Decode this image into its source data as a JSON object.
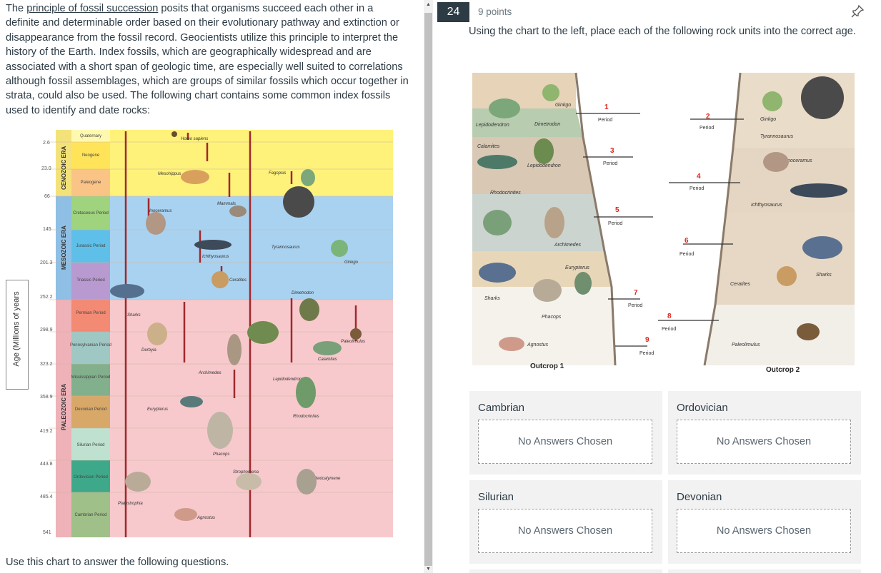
{
  "intro": {
    "link_text": "principle of fossil succession",
    "prefix": "The",
    "body": "posits that organisms succeed each other in a definite and determinable order based on their evolutionary pathway and extinction or disappearance from the fossil record. Geocientists utilize this principle to interpret the history of the Earth. Index fossils, which are geographically widespread and are associated with a short span of geologic time, are especially well suited to correlations although fossil assemblages, which are groups of similar fossils which occur together in strata, could also be used. The following chart contains some common index fossils used to identify and date rocks:"
  },
  "footer_text": "Use this chart to answer the following questions.",
  "chart": {
    "ylabel": "Age (Millions of years",
    "ages": [
      "2.6",
      "23.0",
      "66",
      "145",
      "201.3",
      "252.2",
      "298.9",
      "323.2",
      "358.9",
      "419.2",
      "443.8",
      "485.4",
      "541"
    ],
    "eras": [
      "CENOZOIC ERA",
      "MESOZOIC ERA",
      "PALEOZOIC ERA"
    ],
    "periods": [
      "Quaternary",
      "Neogene",
      "Paleogene",
      "Cretaceous Period",
      "Jurassic Period",
      "Triassic Period",
      "Permian Period",
      "Pennsylvanian Period",
      "Mississippian Period",
      "Devonian Period",
      "Silurian Period",
      "Ordovician Period",
      "Cambrian Period"
    ],
    "fossils": [
      "Homo sapiens",
      "Mesohippus",
      "Fagopsis",
      "Mammals",
      "Inoceramus",
      "Ichthyosaurus",
      "Tyrannosaurus",
      "Ginkgo",
      "Ceratites",
      "Sharks",
      "Dimetrodon",
      "Paleolimulus",
      "Derbyia",
      "Archimedes",
      "Calamites",
      "Lepidodendron",
      "Eurypterus",
      "Rhodocrinites",
      "Phacops",
      "Strophomena",
      "Flexicalymene",
      "Platystrophia",
      "Agnostus"
    ],
    "colors": {
      "cenozoic": "#fff27a",
      "mesozoic": "#a9d2f0",
      "paleozoic": "#f7c9cc",
      "arrow": "#a0282d"
    }
  },
  "question": {
    "number": "24",
    "points": "9 points",
    "text": "Using the chart to the left, place each of the following rock units into the correct age."
  },
  "outcrop": {
    "outcrop1": "Outcrop 1",
    "outcrop2": "Outcrop 2",
    "period_word": "Period",
    "numbers": [
      "1",
      "2",
      "3",
      "4",
      "5",
      "6",
      "7",
      "8",
      "9"
    ],
    "fossils1": [
      "Ginkgo",
      "Lepidodendron",
      "Dimetrodon",
      "Calamites",
      "Lepidodendron",
      "Rhodocrinites",
      "Archimedes",
      "Eurypterus",
      "Sharks",
      "Phacops",
      "Agnostus"
    ],
    "fossils2": [
      "Ginkgo",
      "Tyrannosaurus",
      "Inoceramus",
      "Ichthyosaurus",
      "Sharks",
      "Ceratites",
      "Paleolimulus"
    ]
  },
  "zones": [
    {
      "label": "Cambrian",
      "placeholder": "No Answers Chosen"
    },
    {
      "label": "Ordovician",
      "placeholder": "No Answers Chosen"
    },
    {
      "label": "Silurian",
      "placeholder": "No Answers Chosen"
    },
    {
      "label": "Devonian",
      "placeholder": "No Answers Chosen"
    }
  ]
}
